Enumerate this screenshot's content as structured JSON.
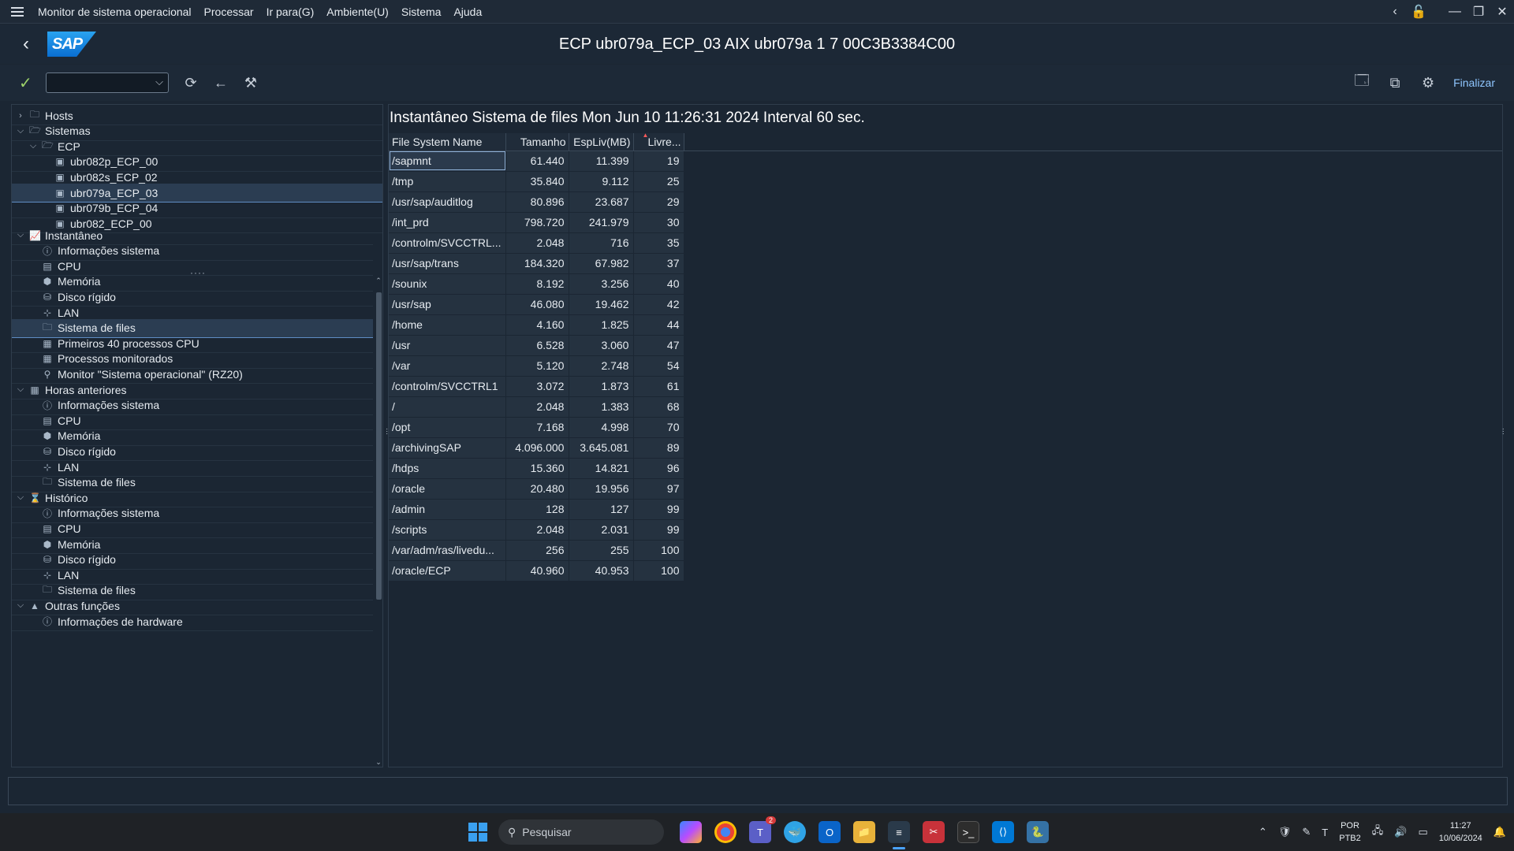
{
  "menubar": {
    "items": [
      "Monitor de sistema operacional",
      "Processar",
      "Ir para(G)",
      "Ambiente(U)",
      "Sistema",
      "Ajuda"
    ]
  },
  "titlebar": {
    "title": "ECP ubr079a_ECP_03 AIX ubr079a 1 7 00C3B3384C00",
    "logo_text": "SAP"
  },
  "toolbar": {
    "command_field_value": "",
    "finalizar_label": "Finalizar"
  },
  "systems_tree": [
    {
      "label": "Hosts",
      "level": 0,
      "twisty": "right",
      "icon": "folder-icon"
    },
    {
      "label": "Sistemas",
      "level": 0,
      "twisty": "down",
      "icon": "folder-open-icon"
    },
    {
      "label": "ECP",
      "level": 1,
      "twisty": "down",
      "icon": "folder-open-icon"
    },
    {
      "label": "ubr082p_ECP_00",
      "level": 2,
      "twisty": "",
      "icon": "server-icon"
    },
    {
      "label": "ubr082s_ECP_02",
      "level": 2,
      "twisty": "",
      "icon": "server-icon"
    },
    {
      "label": "ubr079a_ECP_03",
      "level": 2,
      "twisty": "",
      "icon": "server-icon",
      "selected": true
    },
    {
      "label": "ubr079b_ECP_04",
      "level": 2,
      "twisty": "",
      "icon": "server-icon"
    },
    {
      "label": "ubr082_ECP_00",
      "level": 2,
      "twisty": "",
      "icon": "server-icon"
    }
  ],
  "functions_tree": [
    {
      "label": "Instantâneo",
      "level": 0,
      "twisty": "down",
      "icon": "chart-icon"
    },
    {
      "label": "Informações sistema",
      "level": 1,
      "icon": "info-icon"
    },
    {
      "label": "CPU",
      "level": 1,
      "icon": "cpu-icon"
    },
    {
      "label": "Memória",
      "level": 1,
      "icon": "memory-icon"
    },
    {
      "label": "Disco rígido",
      "level": 1,
      "icon": "disk-icon"
    },
    {
      "label": "LAN",
      "level": 1,
      "icon": "network-icon"
    },
    {
      "label": "Sistema de files",
      "level": 1,
      "icon": "folder-icon",
      "selected": true
    },
    {
      "label": "Primeiros 40 processos CPU",
      "level": 1,
      "icon": "process-icon"
    },
    {
      "label": "Processos monitorados",
      "level": 1,
      "icon": "process-icon"
    },
    {
      "label": "Monitor \"Sistema operacional\" (RZ20)",
      "level": 1,
      "icon": "monitor-search-icon"
    },
    {
      "label": "Horas anteriores",
      "level": 0,
      "twisty": "down",
      "icon": "calendar-icon"
    },
    {
      "label": "Informações sistema",
      "level": 1,
      "icon": "info-icon"
    },
    {
      "label": "CPU",
      "level": 1,
      "icon": "cpu-icon"
    },
    {
      "label": "Memória",
      "level": 1,
      "icon": "memory-icon"
    },
    {
      "label": "Disco rígido",
      "level": 1,
      "icon": "disk-icon"
    },
    {
      "label": "LAN",
      "level": 1,
      "icon": "network-icon"
    },
    {
      "label": "Sistema de files",
      "level": 1,
      "icon": "folder-icon"
    },
    {
      "label": "Histórico",
      "level": 0,
      "twisty": "down",
      "icon": "history-icon"
    },
    {
      "label": "Informações sistema",
      "level": 1,
      "icon": "info-icon"
    },
    {
      "label": "CPU",
      "level": 1,
      "icon": "cpu-icon"
    },
    {
      "label": "Memória",
      "level": 1,
      "icon": "memory-icon"
    },
    {
      "label": "Disco rígido",
      "level": 1,
      "icon": "disk-icon"
    },
    {
      "label": "LAN",
      "level": 1,
      "icon": "network-icon"
    },
    {
      "label": "Sistema de files",
      "level": 1,
      "icon": "folder-icon"
    },
    {
      "label": "Outras funções",
      "level": 0,
      "twisty": "down",
      "icon": "warning-triangle-icon"
    },
    {
      "label": "Informações de hardware",
      "level": 1,
      "icon": "info-icon"
    }
  ],
  "main": {
    "heading": "Instantâneo Sistema de files Mon Jun 10 11:26:31 2024 Interval 60 sec.",
    "columns": [
      "File System Name",
      "Tamanho",
      "EspLiv(MB)",
      "Livre..."
    ],
    "rows": [
      [
        "/sapmnt",
        "61.440",
        "11.399",
        "19"
      ],
      [
        "/tmp",
        "35.840",
        "9.112",
        "25"
      ],
      [
        "/usr/sap/auditlog",
        "80.896",
        "23.687",
        "29"
      ],
      [
        "/int_prd",
        "798.720",
        "241.979",
        "30"
      ],
      [
        "/controlm/SVCCTRL...",
        "2.048",
        "716",
        "35"
      ],
      [
        "/usr/sap/trans",
        "184.320",
        "67.982",
        "37"
      ],
      [
        "/sounix",
        "8.192",
        "3.256",
        "40"
      ],
      [
        "/usr/sap",
        "46.080",
        "19.462",
        "42"
      ],
      [
        "/home",
        "4.160",
        "1.825",
        "44"
      ],
      [
        "/usr",
        "6.528",
        "3.060",
        "47"
      ],
      [
        "/var",
        "5.120",
        "2.748",
        "54"
      ],
      [
        "/controlm/SVCCTRL1",
        "3.072",
        "1.873",
        "61"
      ],
      [
        "/",
        "2.048",
        "1.383",
        "68"
      ],
      [
        "/opt",
        "7.168",
        "4.998",
        "70"
      ],
      [
        "/archivingSAP",
        "4.096.000",
        "3.645.081",
        "89"
      ],
      [
        "/hdps",
        "15.360",
        "14.821",
        "96"
      ],
      [
        "/oracle",
        "20.480",
        "19.956",
        "97"
      ],
      [
        "/admin",
        "128",
        "127",
        "99"
      ],
      [
        "/scripts",
        "2.048",
        "2.031",
        "99"
      ],
      [
        "/var/adm/ras/livedu...",
        "256",
        "255",
        "100"
      ],
      [
        "/oracle/ECP",
        "40.960",
        "40.953",
        "100"
      ]
    ]
  },
  "statusbar": {
    "text": ""
  },
  "taskbar": {
    "search_placeholder": "Pesquisar",
    "teams_badge": "2",
    "language_top": "POR",
    "language_bottom": "PTB2",
    "time": "11:27",
    "date": "10/06/2024"
  },
  "colors": {
    "background": "#1b2633",
    "accent": "#0a6ed1",
    "selection": "#2b3d52",
    "check": "#9ed36a",
    "sort_indicator": "#ff5a5a"
  }
}
